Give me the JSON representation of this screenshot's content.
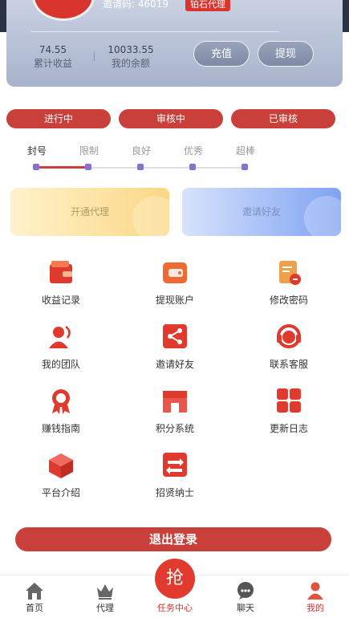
{
  "profile": {
    "invite_code_text": "邀请码: 46019",
    "level_badge": "铂石代理",
    "stats": [
      {
        "value": "74.55",
        "label": "累计收益"
      },
      {
        "value": "10033.55",
        "label": "我的余额"
      }
    ],
    "recharge_label": "充值",
    "withdraw_label": "提现"
  },
  "status_tabs": [
    "进行中",
    "审核中",
    "已审核"
  ],
  "levels": {
    "labels": [
      "封号",
      "限制",
      "良好",
      "优秀",
      "超棒"
    ],
    "current_index": 1
  },
  "promos": {
    "agent_label": "开通代理",
    "invite_label": "邀请好友"
  },
  "menu": [
    {
      "label": "收益记录",
      "icon": "wallet-icon"
    },
    {
      "label": "提现账户",
      "icon": "card-wallet-icon"
    },
    {
      "label": "修改密码",
      "icon": "document-lock-icon"
    },
    {
      "label": "我的团队",
      "icon": "team-icon"
    },
    {
      "label": "邀请好友",
      "icon": "share-icon"
    },
    {
      "label": "联系客服",
      "icon": "headset-icon"
    },
    {
      "label": "赚钱指南",
      "icon": "medal-icon"
    },
    {
      "label": "积分系统",
      "icon": "store-icon"
    },
    {
      "label": "更新日志",
      "icon": "grid-icon"
    },
    {
      "label": "平台介绍",
      "icon": "cube-icon"
    },
    {
      "label": "招贤纳士",
      "icon": "recruit-icon"
    }
  ],
  "logout_label": "退出登录",
  "tabbar": {
    "items": [
      {
        "label": "首页",
        "icon": "home-icon"
      },
      {
        "label": "代理",
        "icon": "crown-icon"
      },
      {
        "label": "任务中心",
        "icon": "grab-icon"
      },
      {
        "label": "聊天",
        "icon": "chat-icon"
      },
      {
        "label": "我的",
        "icon": "user-icon"
      }
    ],
    "center_glyph": "抢",
    "active_index": 4
  },
  "colors": {
    "accent_red": "#c9403a",
    "card_blue": "#a8b3cb",
    "level_dot": "#8b6fd6"
  }
}
